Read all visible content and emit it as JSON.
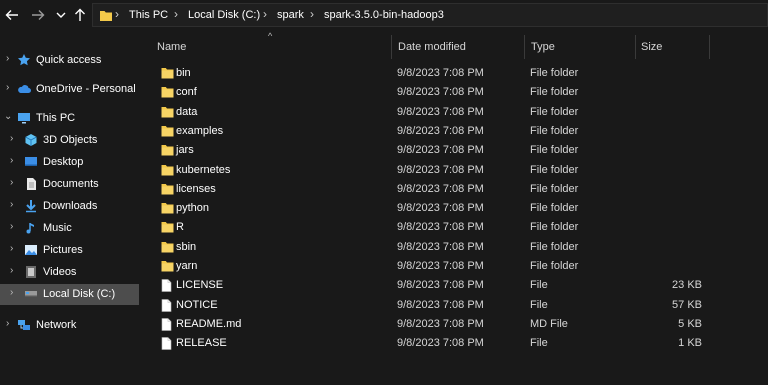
{
  "address_bar": {
    "breadcrumbs": [
      "This PC",
      "Local Disk (C:)",
      "spark",
      "spark-3.5.0-bin-hadoop3"
    ]
  },
  "toolbar": {
    "back_icon": "arrow-left",
    "forward_icon": "arrow-right",
    "recent_icon": "chevron-down",
    "up_icon": "arrow-up"
  },
  "nav_pane": {
    "items": [
      {
        "label": "Quick access",
        "icon": "star"
      },
      {
        "label": "OneDrive - Personal",
        "icon": "cloud"
      },
      {
        "label": "This PC",
        "icon": "monitor"
      },
      {
        "label": "3D Objects",
        "icon": "cube"
      },
      {
        "label": "Desktop",
        "icon": "desktop"
      },
      {
        "label": "Documents",
        "icon": "document"
      },
      {
        "label": "Downloads",
        "icon": "download-arrow"
      },
      {
        "label": "Music",
        "icon": "music-note"
      },
      {
        "label": "Pictures",
        "icon": "picture"
      },
      {
        "label": "Videos",
        "icon": "film"
      },
      {
        "label": "Local Disk (C:)",
        "icon": "drive",
        "selected": true
      },
      {
        "label": "Network",
        "icon": "network"
      }
    ]
  },
  "file_list": {
    "columns": {
      "name": "Name",
      "date": "Date modified",
      "type": "Type",
      "size": "Size"
    },
    "sort_icon": "caret-up",
    "rows": [
      {
        "name": "bin",
        "date": "9/8/2023 7:08 PM",
        "type": "File folder",
        "size": "",
        "icon": "folder"
      },
      {
        "name": "conf",
        "date": "9/8/2023 7:08 PM",
        "type": "File folder",
        "size": "",
        "icon": "folder"
      },
      {
        "name": "data",
        "date": "9/8/2023 7:08 PM",
        "type": "File folder",
        "size": "",
        "icon": "folder"
      },
      {
        "name": "examples",
        "date": "9/8/2023 7:08 PM",
        "type": "File folder",
        "size": "",
        "icon": "folder"
      },
      {
        "name": "jars",
        "date": "9/8/2023 7:08 PM",
        "type": "File folder",
        "size": "",
        "icon": "folder"
      },
      {
        "name": "kubernetes",
        "date": "9/8/2023 7:08 PM",
        "type": "File folder",
        "size": "",
        "icon": "folder"
      },
      {
        "name": "licenses",
        "date": "9/8/2023 7:08 PM",
        "type": "File folder",
        "size": "",
        "icon": "folder"
      },
      {
        "name": "python",
        "date": "9/8/2023 7:08 PM",
        "type": "File folder",
        "size": "",
        "icon": "folder"
      },
      {
        "name": "R",
        "date": "9/8/2023 7:08 PM",
        "type": "File folder",
        "size": "",
        "icon": "folder"
      },
      {
        "name": "sbin",
        "date": "9/8/2023 7:08 PM",
        "type": "File folder",
        "size": "",
        "icon": "folder"
      },
      {
        "name": "yarn",
        "date": "9/8/2023 7:08 PM",
        "type": "File folder",
        "size": "",
        "icon": "folder"
      },
      {
        "name": "LICENSE",
        "date": "9/8/2023 7:08 PM",
        "type": "File",
        "size": "23 KB",
        "icon": "file"
      },
      {
        "name": "NOTICE",
        "date": "9/8/2023 7:08 PM",
        "type": "File",
        "size": "57 KB",
        "icon": "file"
      },
      {
        "name": "README.md",
        "date": "9/8/2023 7:08 PM",
        "type": "MD File",
        "size": "5 KB",
        "icon": "file"
      },
      {
        "name": "RELEASE",
        "date": "9/8/2023 7:08 PM",
        "type": "File",
        "size": "1 KB",
        "icon": "file"
      }
    ]
  },
  "colors": {
    "background": "#191919",
    "selected": "#4d4d4d",
    "folder": "#f3c94a",
    "text": "#ffffff",
    "secondary_text": "#d6d6d6"
  }
}
